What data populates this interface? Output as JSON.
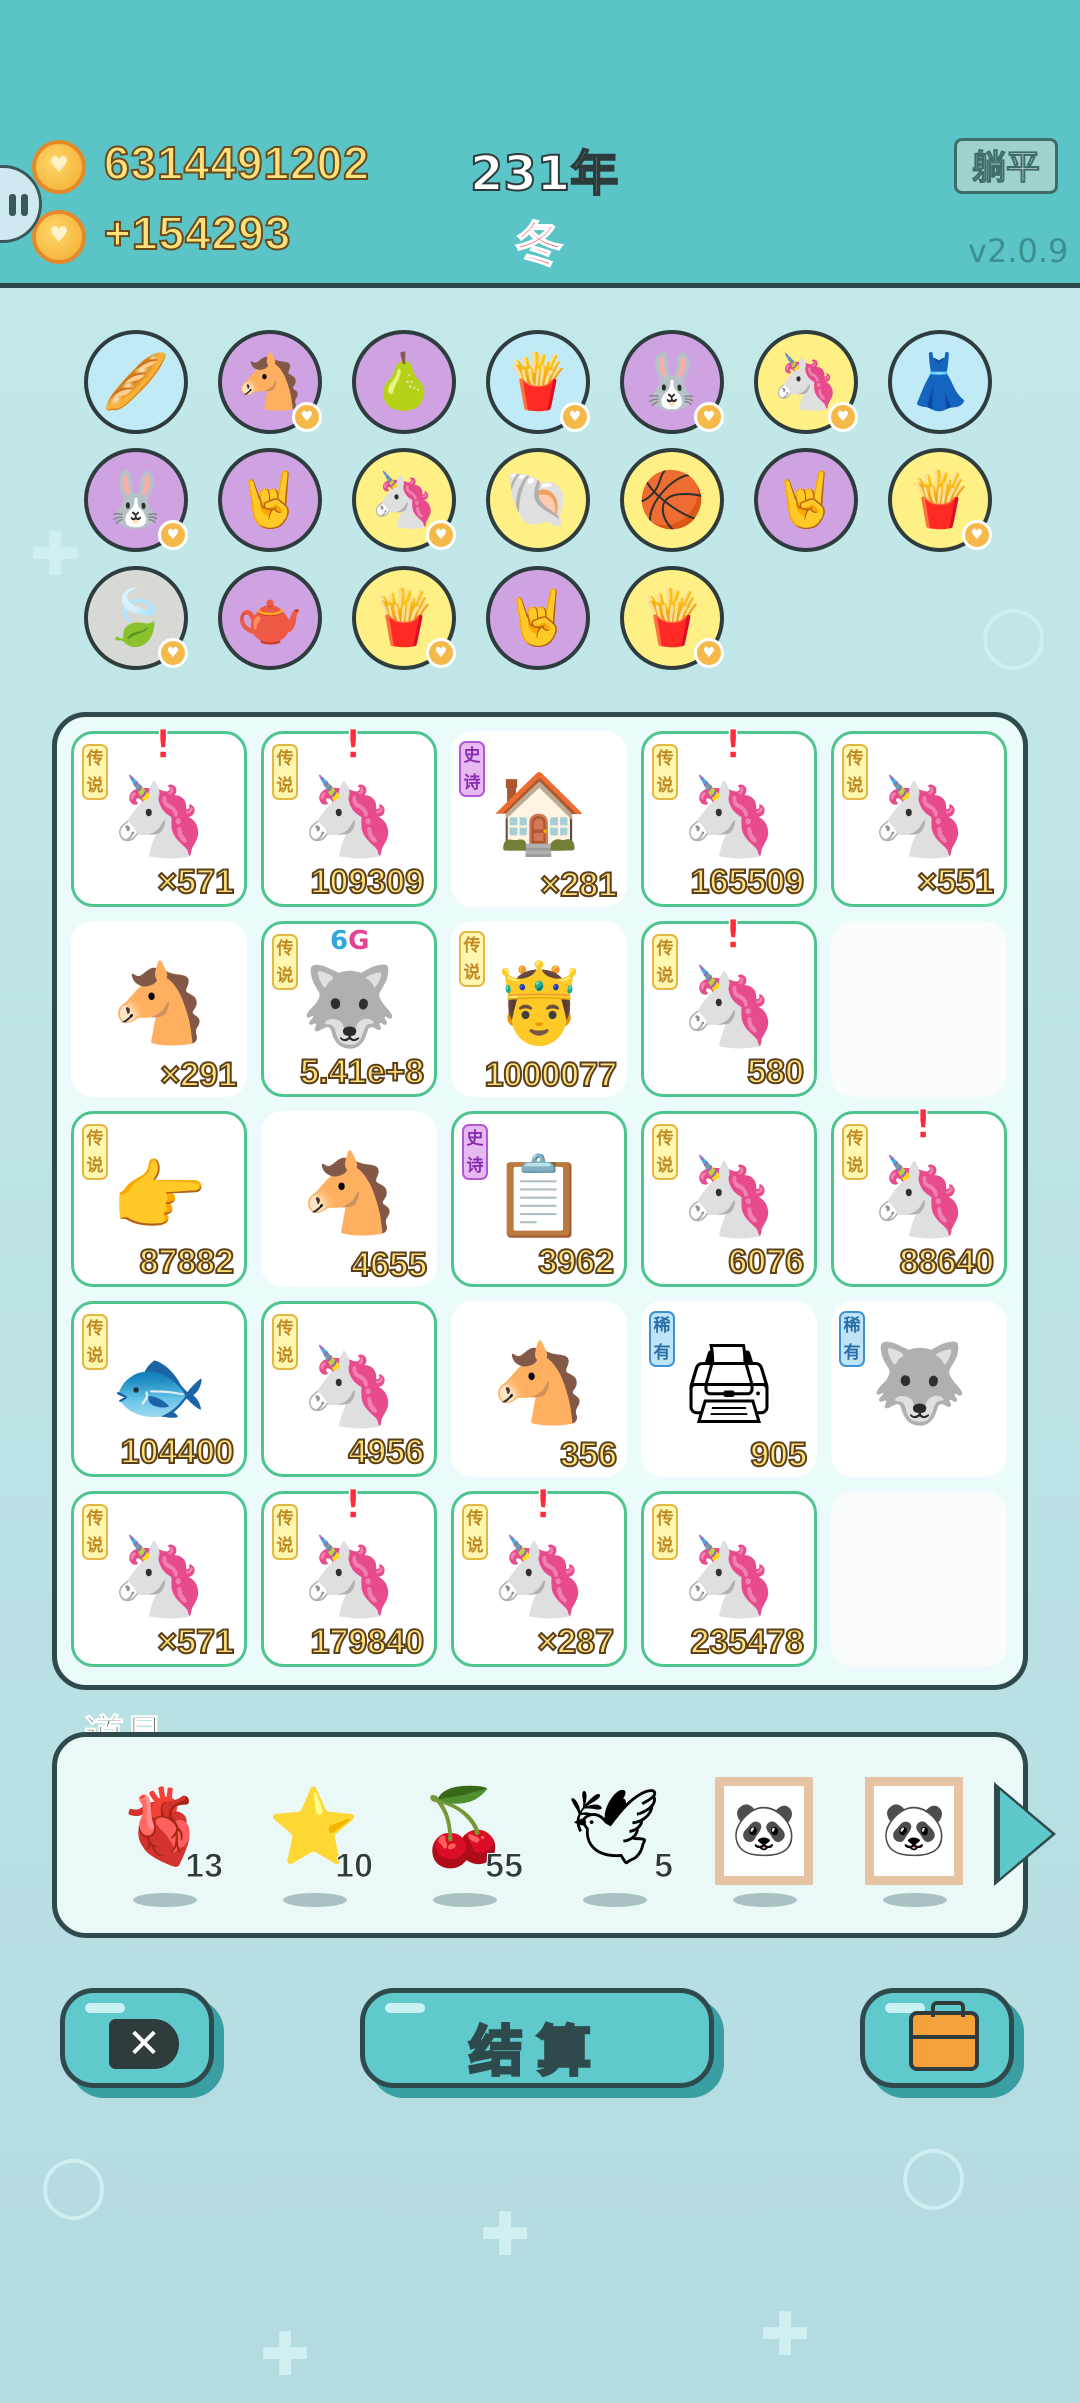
{
  "header": {
    "coins": "6314491202",
    "income": "+154293",
    "year": "231年",
    "season": "冬",
    "flat_button": "躺平",
    "version": "v2.0.9"
  },
  "collection_circles": [
    {
      "icon": "fries-sticks-icon",
      "glyph": "🥖",
      "color": "blue",
      "heart": false
    },
    {
      "icon": "horse-pair-icon",
      "glyph": "🐴",
      "color": "purple",
      "heart": true
    },
    {
      "icon": "pomelo-icon",
      "glyph": "🍐",
      "color": "purple",
      "heart": false
    },
    {
      "icon": "fries-icon",
      "glyph": "🍟",
      "color": "blue",
      "heart": true
    },
    {
      "icon": "rabbit-icon",
      "glyph": "🐰",
      "color": "purple",
      "heart": true
    },
    {
      "icon": "unicorn-icon",
      "glyph": "🦄",
      "color": "yellow",
      "heart": true
    },
    {
      "icon": "skirt-icon",
      "glyph": "👗",
      "color": "blue",
      "heart": false
    },
    {
      "icon": "rabbit-icon",
      "glyph": "🐰",
      "color": "purple",
      "heart": true
    },
    {
      "icon": "rock-hand-icon",
      "glyph": "🤘",
      "color": "purple",
      "heart": false
    },
    {
      "icon": "unicorn-icon",
      "glyph": "🦄",
      "color": "yellow",
      "heart": true
    },
    {
      "icon": "shell-icon",
      "glyph": "🐚",
      "color": "yellow",
      "heart": false
    },
    {
      "icon": "basketballs-icon",
      "glyph": "🏀",
      "color": "yellow",
      "heart": false
    },
    {
      "icon": "rock-hand-icon",
      "glyph": "🤘",
      "color": "purple",
      "heart": false
    },
    {
      "icon": "fries-icon",
      "glyph": "🍟",
      "color": "yellow",
      "heart": true
    },
    {
      "icon": "leaf-icon",
      "glyph": "🍃",
      "color": "gray",
      "heart": true
    },
    {
      "icon": "gravy-boat-icon",
      "glyph": "🫖",
      "color": "purple",
      "heart": false
    },
    {
      "icon": "fries-icon",
      "glyph": "🍟",
      "color": "yellow",
      "heart": true
    },
    {
      "icon": "rock-hand-icon",
      "glyph": "🤘",
      "color": "purple",
      "heart": false
    },
    {
      "icon": "fries-icon",
      "glyph": "🍟",
      "color": "yellow",
      "heart": true
    }
  ],
  "grid": [
    {
      "rarity": "传说",
      "rclass": "legend",
      "icon": "unicorn-icon",
      "glyph": "🦄",
      "count": "×571",
      "mark": true,
      "tier": true
    },
    {
      "rarity": "传说",
      "rclass": "legend",
      "icon": "unicorn-icon",
      "glyph": "🦄",
      "count": "109309",
      "mark": true,
      "tier": true
    },
    {
      "rarity": "史诗",
      "rclass": "epic",
      "icon": "pet-house-icon",
      "glyph": "🏠",
      "count": "×281",
      "mark": false,
      "tier": false
    },
    {
      "rarity": "传说",
      "rclass": "legend",
      "icon": "unicorn-icon",
      "glyph": "🦄",
      "count": "165509",
      "mark": true,
      "tier": true
    },
    {
      "rarity": "传说",
      "rclass": "legend",
      "icon": "unicorn-icon",
      "glyph": "🦄",
      "count": "×551",
      "mark": false,
      "tier": true
    },
    {
      "rarity": "",
      "rclass": "",
      "icon": "horse-icon",
      "glyph": "🐴",
      "count": "×291",
      "mark": false,
      "tier": false
    },
    {
      "rarity": "传说",
      "rclass": "legend",
      "icon": "husky-king-icon",
      "glyph": "🐺",
      "count": "5.41e+8",
      "mark": false,
      "tier": true,
      "tag": "6G"
    },
    {
      "rarity": "传说",
      "rclass": "legend",
      "icon": "bald-king-icon",
      "glyph": "🤴",
      "count": "1000077",
      "mark": false,
      "tier": false
    },
    {
      "rarity": "传说",
      "rclass": "legend",
      "icon": "unicorn-icon",
      "glyph": "🦄",
      "count": "580",
      "mark": true,
      "tier": true
    },
    {
      "rarity": "",
      "rclass": "",
      "icon": "",
      "glyph": "",
      "count": "",
      "mark": false,
      "tier": false,
      "empty": true
    },
    {
      "rarity": "传说",
      "rclass": "legend",
      "icon": "pointing-hand-icon",
      "glyph": "👉",
      "count": "87882",
      "mark": false,
      "tier": true
    },
    {
      "rarity": "",
      "rclass": "",
      "icon": "horse-icon",
      "glyph": "🐴",
      "count": "4655",
      "mark": false,
      "tier": false
    },
    {
      "rarity": "史诗",
      "rclass": "epic",
      "icon": "ctrl-cv-icon",
      "glyph": "📋",
      "count": "3962",
      "mark": false,
      "tier": true
    },
    {
      "rarity": "传说",
      "rclass": "legend",
      "icon": "unicorn-king-icon",
      "glyph": "🦄",
      "count": "6076",
      "mark": false,
      "tier": true
    },
    {
      "rarity": "传说",
      "rclass": "legend",
      "icon": "unicorn-icon",
      "glyph": "🦄",
      "count": "88640",
      "mark": true,
      "tier": true
    },
    {
      "rarity": "传说",
      "rclass": "legend",
      "icon": "koi-fish-icon",
      "glyph": "🐟",
      "count": "104400",
      "mark": false,
      "tier": true
    },
    {
      "rarity": "传说",
      "rclass": "legend",
      "icon": "unicorn-king-icon",
      "glyph": "🦄",
      "count": "4956",
      "mark": false,
      "tier": true
    },
    {
      "rarity": "",
      "rclass": "",
      "icon": "horse-icon",
      "glyph": "🐴",
      "count": "356",
      "mark": false,
      "tier": false
    },
    {
      "rarity": "稀有",
      "rclass": "rare",
      "icon": "printer-icon",
      "glyph": "🖨",
      "count": "905",
      "mark": false,
      "tier": false
    },
    {
      "rarity": "稀有",
      "rclass": "rare",
      "icon": "husky-icon",
      "glyph": "🐺",
      "count": "",
      "mark": false,
      "tier": false
    },
    {
      "rarity": "传说",
      "rclass": "legend",
      "icon": "unicorn-icon",
      "glyph": "🦄",
      "count": "×571",
      "mark": false,
      "tier": true
    },
    {
      "rarity": "传说",
      "rclass": "legend",
      "icon": "unicorn-icon",
      "glyph": "🦄",
      "count": "179840",
      "mark": true,
      "tier": true
    },
    {
      "rarity": "传说",
      "rclass": "legend",
      "icon": "unicorn-icon",
      "glyph": "🦄",
      "count": "×287",
      "mark": true,
      "tier": true
    },
    {
      "rarity": "传说",
      "rclass": "legend",
      "icon": "unicorn-icon",
      "glyph": "🦄",
      "count": "235478",
      "mark": false,
      "tier": true
    },
    {
      "rarity": "",
      "rclass": "",
      "icon": "",
      "glyph": "",
      "count": "",
      "mark": false,
      "tier": false,
      "empty": true
    }
  ],
  "props": {
    "title": "道具",
    "items": [
      {
        "icon": "liver-icon",
        "glyph": "🫀",
        "count": "13"
      },
      {
        "icon": "star-icon",
        "glyph": "⭐",
        "count": "10"
      },
      {
        "icon": "bayberry-icon",
        "glyph": "🍒",
        "count": "55"
      },
      {
        "icon": "pigeon-icon",
        "glyph": "🕊",
        "count": "5"
      },
      {
        "icon": "panda-frame-icon",
        "glyph": "🐼",
        "count": ""
      },
      {
        "icon": "panda-frame-icon",
        "glyph": "🐼",
        "count": ""
      }
    ]
  },
  "footer": {
    "settle_label": "结算"
  },
  "colors": {
    "header_bg": "#5bc4c6",
    "coin_text": "#ffe07a",
    "season_red": "#e53b4a",
    "legend_border": "#4ec58f"
  }
}
